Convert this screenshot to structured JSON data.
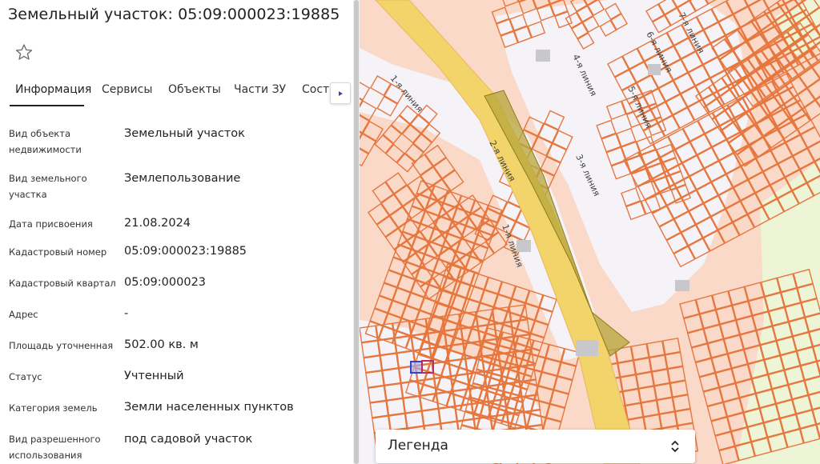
{
  "page": {
    "title": "Земельный участок: 05:09:000023:19885"
  },
  "tabs": [
    {
      "label": "Информация",
      "active": true
    },
    {
      "label": "Сервисы",
      "active": false
    },
    {
      "label": "Объекты",
      "active": false
    },
    {
      "label": "Части ЗУ",
      "active": false
    },
    {
      "label": "Соста",
      "active": false
    }
  ],
  "info": [
    {
      "label": "Вид объекта недвижимости",
      "value": "Земельный участок"
    },
    {
      "label": "Вид земельного участка",
      "value": "Землепользование"
    },
    {
      "label": "Дата присвоения",
      "value": "21.08.2024"
    },
    {
      "label": "Кадастровый номер",
      "value": "05:09:000023:19885"
    },
    {
      "label": "Кадастровый квартал",
      "value": "05:09:000023"
    },
    {
      "label": "Адрес",
      "value": "-"
    },
    {
      "label": "Площадь уточненная",
      "value": "502.00 кв. м"
    },
    {
      "label": "Статус",
      "value": "Учтенный"
    },
    {
      "label": "Категория земель",
      "value": "Земли населенных пунктов"
    },
    {
      "label": "Вид разрешенного использования",
      "value": "под садовой участок"
    }
  ],
  "map": {
    "streets": [
      "1-я линия",
      "2-я линия",
      "3-я линия",
      "4-я линия",
      "5-я линия",
      "6-я линия",
      "7-я линия",
      "1-я линия"
    ],
    "colors": {
      "parcel_fill": "#fbd9c8",
      "parcel_stroke": "#e5773f",
      "road": "#f2d46b",
      "highlight": "#b5a53a",
      "block": "#f5f3f8",
      "green": "#eef4d6"
    }
  },
  "legend": {
    "label": "Легенда",
    "icon": "chevron-up-down-icon"
  },
  "icons": {
    "star": "star-outline-icon",
    "tab_next": "chevron-right-icon"
  }
}
